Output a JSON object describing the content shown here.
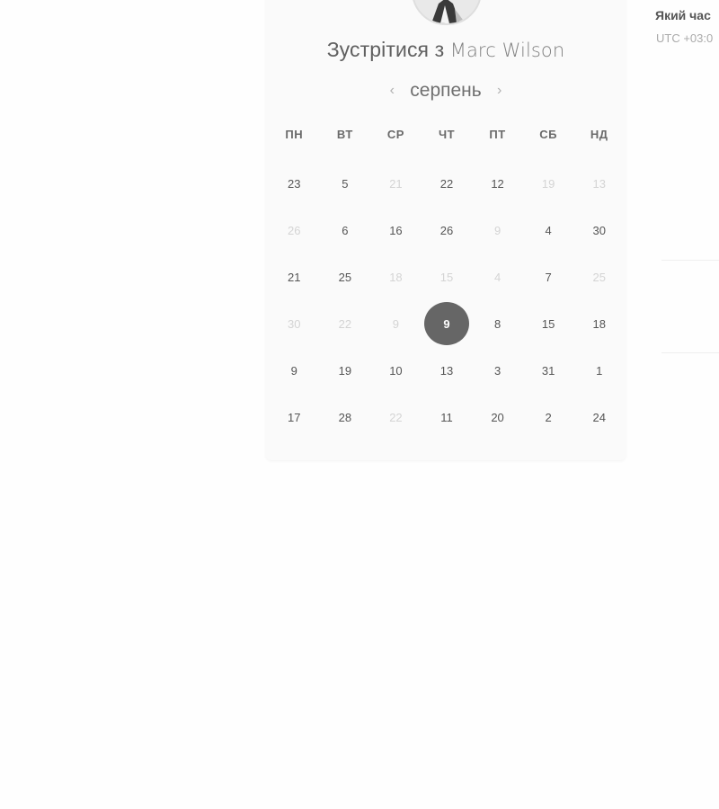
{
  "booking": {
    "title_prefix": "Зустрітися з",
    "host_name": "Marc Wilson"
  },
  "calendar": {
    "month": "серпень",
    "prev_icon": "chevron-left-icon",
    "next_icon": "chevron-right-icon",
    "weekdays": [
      "ПН",
      "ВТ",
      "СР",
      "ЧТ",
      "ПТ",
      "СБ",
      "НД"
    ],
    "selected_day": "9",
    "days": [
      {
        "label": "23",
        "available": true
      },
      {
        "label": "5",
        "available": true
      },
      {
        "label": "21",
        "available": false
      },
      {
        "label": "22",
        "available": true
      },
      {
        "label": "12",
        "available": true
      },
      {
        "label": "19",
        "available": false
      },
      {
        "label": "13",
        "available": false
      },
      {
        "label": "26",
        "available": false
      },
      {
        "label": "6",
        "available": true
      },
      {
        "label": "16",
        "available": true
      },
      {
        "label": "26",
        "available": true
      },
      {
        "label": "9",
        "available": false
      },
      {
        "label": "4",
        "available": true
      },
      {
        "label": "30",
        "available": true
      },
      {
        "label": "21",
        "available": true
      },
      {
        "label": "25",
        "available": true
      },
      {
        "label": "18",
        "available": false
      },
      {
        "label": "15",
        "available": false
      },
      {
        "label": "4",
        "available": false
      },
      {
        "label": "7",
        "available": true
      },
      {
        "label": "25",
        "available": false
      },
      {
        "label": "30",
        "available": false
      },
      {
        "label": "22",
        "available": false
      },
      {
        "label": "9",
        "available": false
      },
      {
        "label": "9",
        "available": true,
        "selected": true
      },
      {
        "label": "8",
        "available": true
      },
      {
        "label": "15",
        "available": true
      },
      {
        "label": "18",
        "available": true
      },
      {
        "label": "9",
        "available": true
      },
      {
        "label": "19",
        "available": true
      },
      {
        "label": "10",
        "available": true
      },
      {
        "label": "13",
        "available": true
      },
      {
        "label": "3",
        "available": true
      },
      {
        "label": "31",
        "available": true
      },
      {
        "label": "1",
        "available": true
      },
      {
        "label": "17",
        "available": true
      },
      {
        "label": "28",
        "available": true
      },
      {
        "label": "22",
        "available": false
      },
      {
        "label": "11",
        "available": true
      },
      {
        "label": "20",
        "available": true
      },
      {
        "label": "2",
        "available": true
      },
      {
        "label": "24",
        "available": true
      }
    ]
  },
  "timezone": {
    "question": "Який час",
    "value": "UTC +03:0"
  },
  "colors": {
    "selected_bg": "#666666",
    "available_text": "#555555",
    "unavailable_text": "#d4d4d4"
  }
}
